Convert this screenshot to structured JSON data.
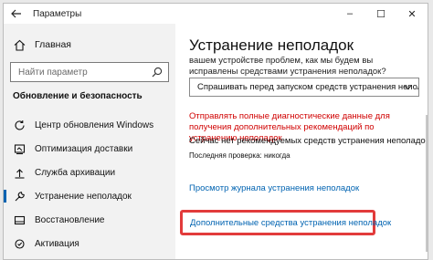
{
  "window": {
    "title": "Параметры",
    "controls": [
      "–",
      "☐",
      "✕"
    ]
  },
  "sidebar": {
    "home_label": "Главная",
    "search_placeholder": "Найти параметр",
    "section_title": "Обновление и безопасность",
    "items": [
      {
        "label": "Центр обновления Windows",
        "icon": "refresh-icon"
      },
      {
        "label": "Оптимизация доставки",
        "icon": "delivery-icon"
      },
      {
        "label": "Служба архивации",
        "icon": "backup-icon"
      },
      {
        "label": "Устранение неполадок",
        "icon": "wrench-icon",
        "selected": true
      },
      {
        "label": "Восстановление",
        "icon": "recovery-icon"
      },
      {
        "label": "Активация",
        "icon": "activation-icon"
      }
    ]
  },
  "main": {
    "title": "Устранение неполадок",
    "description": "вашем устройстве проблем, как мы будем вы исправлены средствами устранения неполадок?",
    "select_value": "Спрашивать перед запуском средств устранения неполад",
    "warning": "Отправлять полные диагностические данные для получения дополнительных рекомендаций по устранению неполадок",
    "status": "Сейчас нет рекомендуемых средств устранения неполадок",
    "last_check": "Последняя проверка: никогда",
    "history_link": "Просмотр журнала устранения неполадок",
    "additional_link": "Дополнительные средства устранения неполадок"
  },
  "colors": {
    "accent": "#0063b1",
    "warning": "#d00000",
    "highlight": "#e23b3b"
  }
}
